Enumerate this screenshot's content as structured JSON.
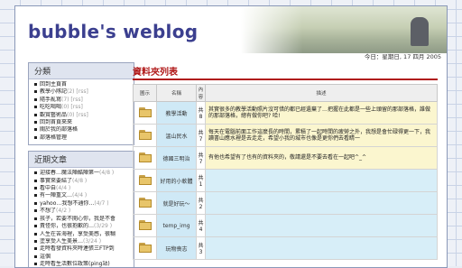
{
  "blog": {
    "title": "bubble's weblog",
    "date": "今日：星期日, 17 四月 2005"
  },
  "sidebar": {
    "categories_title": "分類",
    "categories": [
      {
        "label": "回到主頁首",
        "meta": ""
      },
      {
        "label": "教學小隊記",
        "meta": "(2) [rss]"
      },
      {
        "label": "隨手亂寫",
        "meta": "(7) [rss]"
      },
      {
        "label": "吃吃喝喝",
        "meta": "(0) [rss]"
      },
      {
        "label": "觀賞藝術品",
        "meta": "(0) [rss]"
      },
      {
        "label": "回到首頁來來",
        "meta": ""
      },
      {
        "label": "關於我的部落格",
        "meta": ""
      },
      {
        "label": "部落格管理",
        "meta": ""
      }
    ],
    "recent_title": "近期文章",
    "recent": [
      {
        "label": "迎接春…魔法陣酷陣第一",
        "meta": "(4/8 )"
      },
      {
        "label": "事實來要結了",
        "meta": "(4/8 )"
      },
      {
        "label": "看中自",
        "meta": "(4/4 )"
      },
      {
        "label": "有一陣重文…",
        "meta": "(4/4 )"
      },
      {
        "label": "yahoo…我想不通你…",
        "meta": "(4/7 )"
      },
      {
        "label": "不想了",
        "meta": "(4/2 )"
      },
      {
        "label": "孩子，若要不開心你，我是不會",
        "meta": ""
      },
      {
        "label": "責怪你，也很抱歉的…",
        "meta": "(3/29 )"
      },
      {
        "label": "人生在苦海裡，享受美感，很糊",
        "meta": ""
      },
      {
        "label": "塗享受人生美景…",
        "meta": "(3/24 )"
      },
      {
        "label": "走時看發資料夾時連張三FTP到",
        "meta": ""
      },
      {
        "label": "這個",
        "meta": ""
      },
      {
        "label": "走時看生活數位政策(ping站)",
        "meta": ""
      }
    ]
  },
  "main": {
    "heading": "資料夾列表",
    "columns": [
      "圖示",
      "名稱",
      "內容",
      "描述"
    ],
    "folders": [
      {
        "name": "教學活動",
        "count": "共8",
        "desc": "其實很多的教學活動照片沒可惜的都已經遺棄了…把握在此都是一些上頭留的那部落格，誰做的那部落格，總有做你吧? 哈!",
        "hl": true
      },
      {
        "name": "溫山民水",
        "count": "共7",
        "desc": "每天在電腦前面工作這麼長的時間，累積了一起時間的疲勞之外，我想是會忙碌得更一下，我讀書山應水裡是去走走，希望小我的城市也像是更你們去看睛一",
        "hl": true
      },
      {
        "name": "德國三明治",
        "count": "共7",
        "desc": "有他也希望有了也有的資料夾的，敬請還是不要去看在一起吧^_^",
        "hl": true
      },
      {
        "name": "好用的小軟體",
        "count": "共1",
        "desc": "",
        "hl": false
      },
      {
        "name": "就是好玩～",
        "count": "共2",
        "desc": "",
        "hl": false
      },
      {
        "name": "temp_img",
        "count": "共4",
        "desc": "",
        "hl": false
      },
      {
        "name": "玩物喪志",
        "count": "共3",
        "desc": "",
        "hl": false
      }
    ]
  }
}
